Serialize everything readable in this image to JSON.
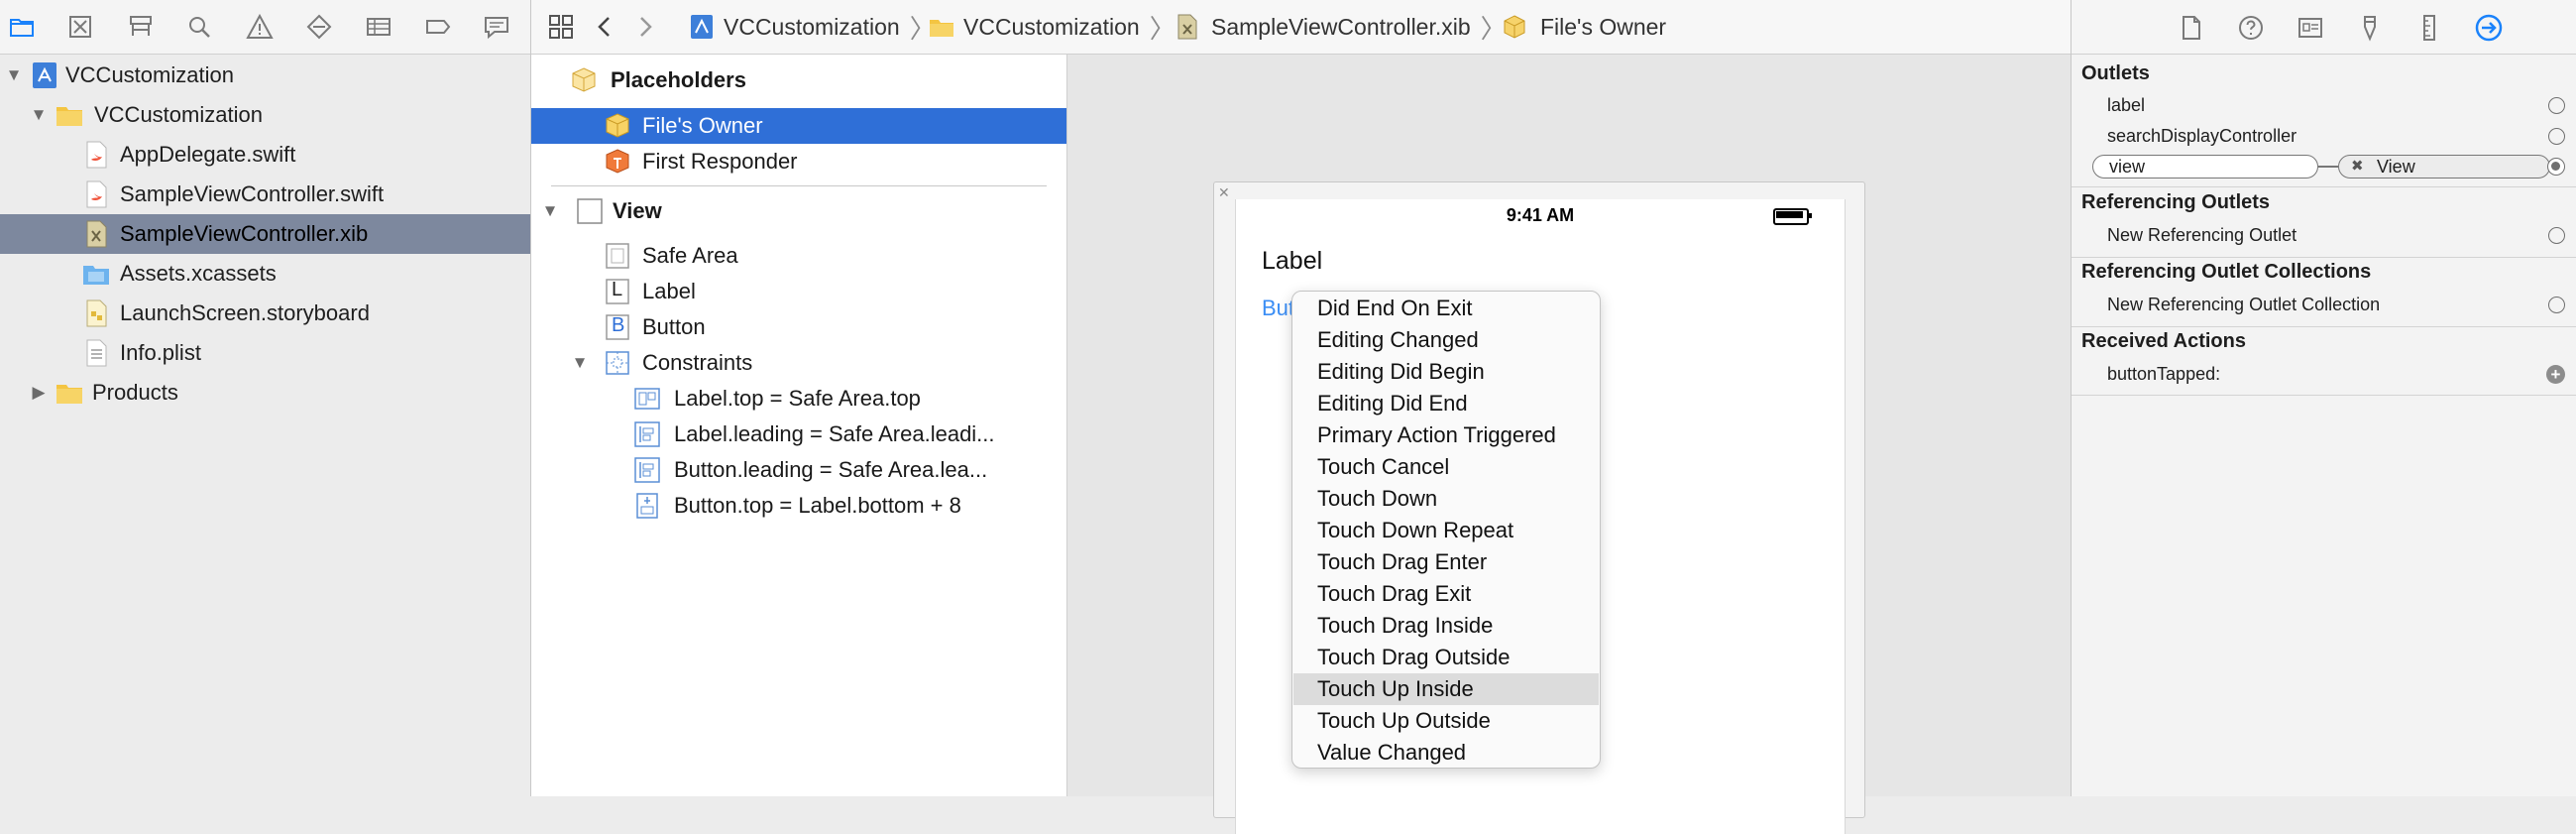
{
  "navigator": {
    "toolbar_icons": [
      "folder-icon",
      "source-control-icon",
      "hierarchy-icon",
      "find-icon",
      "issue-icon",
      "test-icon",
      "debug-icon",
      "breakpoint-icon",
      "report-icon"
    ],
    "tree": [
      {
        "label": "VCCustomization",
        "icon": "xcode-project-icon",
        "level": 0,
        "expanded": true
      },
      {
        "label": "VCCustomization",
        "icon": "folder-icon",
        "level": 1,
        "expanded": true
      },
      {
        "label": "AppDelegate.swift",
        "icon": "swift-file-icon",
        "level": 2
      },
      {
        "label": "SampleViewController.swift",
        "icon": "swift-file-icon",
        "level": 2
      },
      {
        "label": "SampleViewController.xib",
        "icon": "xib-file-icon",
        "level": 2,
        "selected": true
      },
      {
        "label": "Assets.xcassets",
        "icon": "asset-catalog-icon",
        "level": 2
      },
      {
        "label": "LaunchScreen.storyboard",
        "icon": "storyboard-icon",
        "level": 2
      },
      {
        "label": "Info.plist",
        "icon": "plist-icon",
        "level": 2
      },
      {
        "label": "Products",
        "icon": "folder-icon",
        "level": 0,
        "expanded": false
      }
    ]
  },
  "jumpbar": {
    "crumbs": [
      "VCCustomization",
      "VCCustomization",
      "SampleViewController.xib",
      "File's Owner"
    ]
  },
  "outline": {
    "placeholders_header": "Placeholders",
    "files_owner": "File's Owner",
    "first_responder": "First Responder",
    "view": "View",
    "safe_area": "Safe Area",
    "label": "Label",
    "button": "Button",
    "constraints": "Constraints",
    "constraint_items": [
      "Label.top = Safe Area.top",
      "Label.leading = Safe Area.leadi...",
      "Button.leading = Safe Area.lea...",
      "Button.top = Label.bottom + 8"
    ],
    "label_glyph": "L",
    "button_glyph": "B"
  },
  "canvas": {
    "status_time": "9:41 AM",
    "ui_label": "Label",
    "ui_button": "Butt"
  },
  "menu": {
    "items": [
      "Did End On Exit",
      "Editing Changed",
      "Editing Did Begin",
      "Editing Did End",
      "Primary Action Triggered",
      "Touch Cancel",
      "Touch Down",
      "Touch Down Repeat",
      "Touch Drag Enter",
      "Touch Drag Exit",
      "Touch Drag Inside",
      "Touch Drag Outside",
      "Touch Up Inside",
      "Touch Up Outside",
      "Value Changed"
    ],
    "highlighted": "Touch Up Inside"
  },
  "inspector": {
    "tabs": [
      "file-inspector-icon",
      "quick-help-icon",
      "identity-inspector-icon",
      "attributes-inspector-icon",
      "size-inspector-icon",
      "connections-inspector-icon"
    ],
    "active_tab": "connections-inspector-icon",
    "outlets_header": "Outlets",
    "outlets": [
      "label",
      "searchDisplayController"
    ],
    "view_outlet": "view",
    "view_target": "View",
    "referencing_outlets_header": "Referencing Outlets",
    "new_referencing_outlet": "New Referencing Outlet",
    "referencing_collections_header": "Referencing Outlet Collections",
    "new_referencing_collection": "New Referencing Outlet Collection",
    "received_actions_header": "Received Actions",
    "action": "buttonTapped:",
    "add_symbol": "+",
    "x_symbol": "✖"
  },
  "colors": {
    "selection_blue": "#2f6fd7",
    "navigator_selection": "#7d889e",
    "link_blue": "#3b8ef5",
    "accent": "#1a82fb"
  }
}
